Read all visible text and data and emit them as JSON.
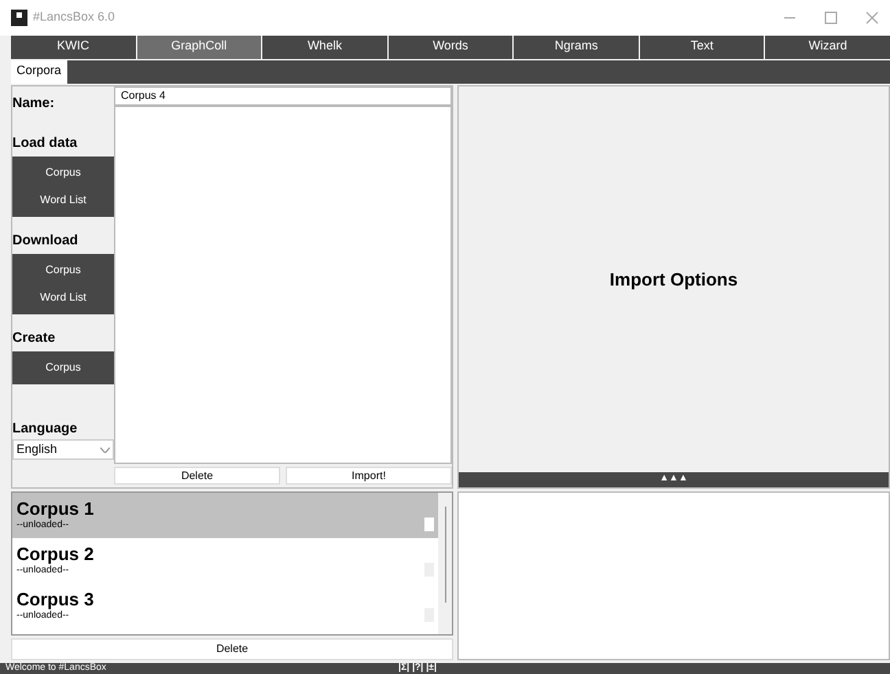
{
  "window": {
    "title": "#LancsBox 6.0"
  },
  "tabs": [
    {
      "label": "KWIC",
      "selected": false
    },
    {
      "label": "GraphColl",
      "selected": true
    },
    {
      "label": "Whelk",
      "selected": false
    },
    {
      "label": "Words",
      "selected": false
    },
    {
      "label": "Ngrams",
      "selected": false
    },
    {
      "label": "Text",
      "selected": false
    },
    {
      "label": "Wizard",
      "selected": false
    }
  ],
  "subtabs": [
    {
      "label": "Corpora",
      "selected": true
    }
  ],
  "sidebar": {
    "name_label": "Name:",
    "sections": [
      {
        "heading": "Load data",
        "buttons": [
          "Corpus",
          "Word List"
        ]
      },
      {
        "heading": "Download",
        "buttons": [
          "Corpus",
          "Word List"
        ]
      },
      {
        "heading": "Create",
        "buttons": [
          "Corpus"
        ]
      }
    ],
    "language_label": "Language",
    "language": "English"
  },
  "name_field": {
    "value": "Corpus 4"
  },
  "file_buttons": [
    "Delete",
    "Import!"
  ],
  "import_options": {
    "title": "Import Options",
    "toggle": "▲▲▲"
  },
  "corpora": [
    {
      "name": "Corpus 1",
      "status": "--unloaded--",
      "selected": true
    },
    {
      "name": "Corpus 2",
      "status": "--unloaded--",
      "selected": false
    },
    {
      "name": "Corpus 3",
      "status": "--unloaded--",
      "selected": false
    }
  ],
  "corpora_delete": "Delete",
  "status_bar": {
    "message": "Welcome to #LancsBox",
    "tools": "|Σ| |?| |±|"
  }
}
